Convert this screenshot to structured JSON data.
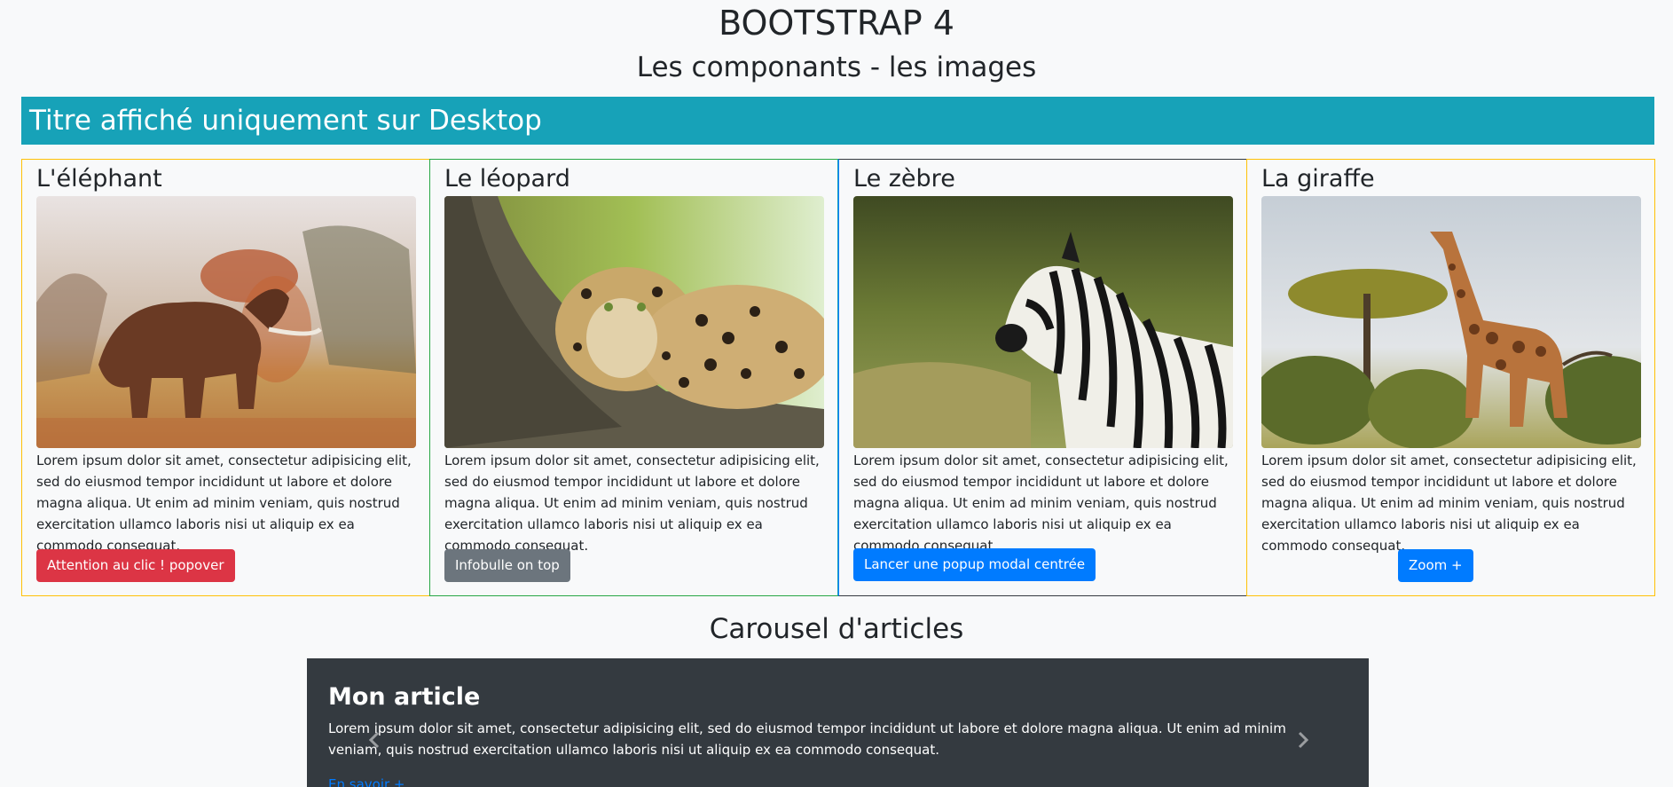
{
  "header": {
    "title": "BOOTSTRAP 4",
    "subtitle": "Les componants - les images"
  },
  "banner": {
    "text": "Titre affiché uniquement sur Desktop"
  },
  "cards": [
    {
      "title": "L'éléphant",
      "image": "elephant-photo",
      "text": "Lorem ipsum dolor sit amet, consectetur adipisicing elit, sed do eiusmod tempor incididunt ut labore et dolore magna aliqua. Ut enim ad minim veniam, quis nostrud exercitation ullamco laboris nisi ut aliquip ex ea commodo consequat.",
      "button": "Attention au clic ! popover",
      "button_color": "#dc3545"
    },
    {
      "title": "Le léopard",
      "image": "leopard-photo",
      "text": "Lorem ipsum dolor sit amet, consectetur adipisicing elit, sed do eiusmod tempor incididunt ut labore et dolore magna aliqua. Ut enim ad minim veniam, quis nostrud exercitation ullamco laboris nisi ut aliquip ex ea commodo consequat.",
      "button": "Infobulle on top",
      "button_color": "#6c757d"
    },
    {
      "title": "Le zèbre",
      "image": "zebra-photo",
      "text": "Lorem ipsum dolor sit amet, consectetur adipisicing elit, sed do eiusmod tempor incididunt ut labore et dolore magna aliqua. Ut enim ad minim veniam, quis nostrud exercitation ullamco laboris nisi ut aliquip ex ea commodo consequat.",
      "button": "Lancer une popup modal centrée",
      "button_color": "#007bff"
    },
    {
      "title": "La giraffe",
      "image": "giraffe-photo",
      "text": "Lorem ipsum dolor sit amet, consectetur adipisicing elit, sed do eiusmod tempor incididunt ut labore et dolore magna aliqua. Ut enim ad minim veniam, quis nostrud exercitation ullamco laboris nisi ut aliquip ex ea commodo consequat.",
      "button": "Zoom +",
      "button_color": "#007bff"
    }
  ],
  "carousel": {
    "heading": "Carousel d'articles",
    "article_title": "Mon article",
    "article_text": "Lorem ipsum dolor sit amet, consectetur adipisicing elit, sed do eiusmod tempor incididunt ut labore et dolore magna aliqua. Ut enim ad minim veniam, quis nostrud exercitation ullamco laboris nisi ut aliquip ex ea commodo consequat.",
    "link": "En savoir +",
    "prev_icon": "chevron-left-icon",
    "next_icon": "chevron-right-icon"
  },
  "colors": {
    "banner": "#17a2b8",
    "carousel_bg": "#343a40",
    "card_border": "#ffc107",
    "link": "#007bff"
  }
}
